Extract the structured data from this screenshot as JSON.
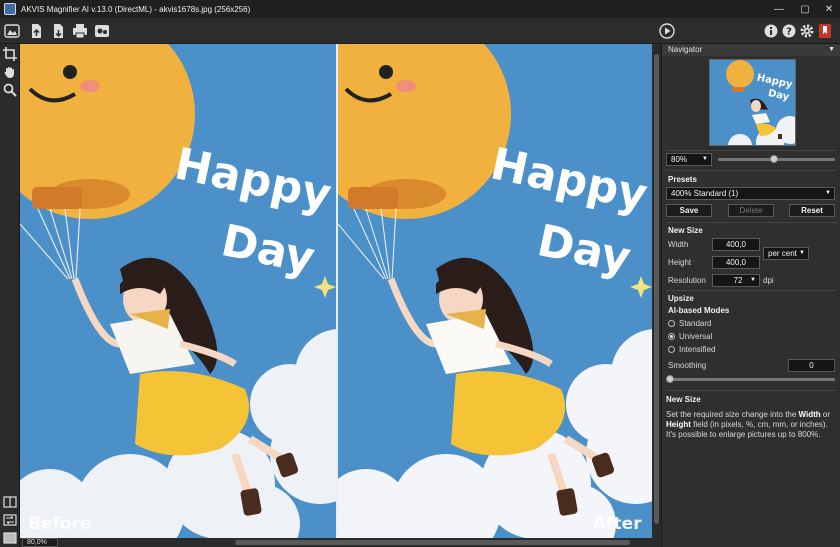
{
  "window": {
    "title": "AKVIS Magnifier AI v.13.0 (DirectML) - akvis1678s.jpg (256x256)",
    "controls": [
      "minimize-icon",
      "maximize-icon",
      "close-icon"
    ]
  },
  "toolbar": {
    "left_icons": [
      "home-icon",
      "open-file-icon",
      "save-file-icon",
      "print-icon",
      "batch-icon"
    ],
    "run_icon": "play-icon",
    "right_icons": [
      "info-icon",
      "help-icon",
      "settings-icon",
      "bookmark-icon"
    ]
  },
  "left_tools": [
    "crop-icon",
    "hand-icon",
    "zoom-icon"
  ],
  "left_bottom_tools": [
    "split-view-icon",
    "compare-icon",
    "single-view-icon"
  ],
  "canvas": {
    "before_label": "Before",
    "after_label": "After",
    "image_text_line1": "Happy",
    "image_text_line2": "Day"
  },
  "status": {
    "zoom": "80,0%"
  },
  "panel": {
    "navigator_title": "Navigator",
    "nav_thumb_text1": "Happy",
    "nav_thumb_text2": "Day",
    "zoom_value": "80%",
    "zoom_slider_fraction": 0.48,
    "presets_title": "Presets",
    "preset_value": "400% Standard (1)",
    "save_label": "Save",
    "delete_label": "Delete",
    "reset_label": "Reset",
    "new_size_title": "New Size",
    "width_label": "Width",
    "width_value": "400,0",
    "unit_value": "per cent",
    "height_label": "Height",
    "height_value": "400,0",
    "resolution_label": "Resolution",
    "resolution_value": "72",
    "resolution_unit": "dpi",
    "upsize_title": "Upsize",
    "modes_title": "AI-based Modes",
    "modes": [
      {
        "label": "Standard",
        "selected": false
      },
      {
        "label": "Universal",
        "selected": true
      },
      {
        "label": "Intensified",
        "selected": false
      }
    ],
    "smoothing_label": "Smoothing",
    "smoothing_value": "0",
    "help_title": "New Size",
    "help_text_1": "Set the required size change into the ",
    "help_bold_1": "Width",
    "help_text_2": " or ",
    "help_bold_2": "Height",
    "help_text_3": " field (in pixels, %, cm, mm, or inches). It's possible to enlarge pictures up to 800%."
  },
  "colors": {
    "sky": "#4b90c9",
    "balloon": "#f0b13e",
    "skirt": "#f4c336",
    "bookmark": "#c0392b"
  }
}
